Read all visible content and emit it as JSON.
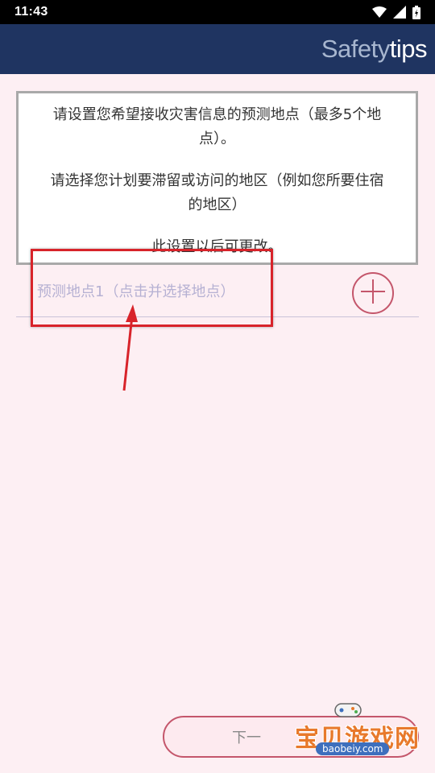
{
  "status_bar": {
    "time": "11:43",
    "icons": [
      "wifi-icon",
      "signal-icon",
      "battery-icon"
    ]
  },
  "header": {
    "title_part1": "Safety",
    "title_part2": "tips",
    "background": "#1f3461"
  },
  "info": {
    "line1": "请设置您希望接收灾害信息的预测地点（最多5个地",
    "line2": "点）。",
    "line3": "请选择您计划要滞留或访问的地区（例如您所要住宿",
    "line4": "的地区）",
    "line5": "此设置以后可更改。"
  },
  "location": {
    "placeholder": "预测地点1（点击并选择地点）",
    "add_icon": "plus-icon"
  },
  "next_button": {
    "label": "下一"
  },
  "watermark": {
    "text": "宝贝游戏网",
    "url": "baobeiy.com"
  },
  "colors": {
    "background": "#fdeff3",
    "accent": "#c4566b",
    "annotation": "#d8232a"
  }
}
